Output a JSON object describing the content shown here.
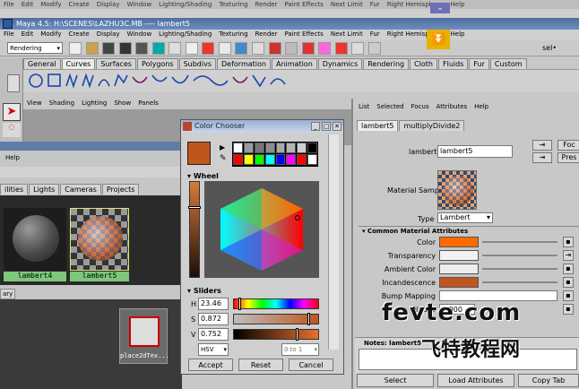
{
  "app_title_back": "Maya 4.5: H:\\SCENES\\LAZHU3C.MB  ----  lambert5",
  "app_title_front": "Maya 4.5: H:\\SCENES\\LAZHU3C.MB  ----  lambert5",
  "menubar": [
    "File",
    "Edit",
    "Modify",
    "Create",
    "Display",
    "Window",
    "Lighting/Shading",
    "Texturing",
    "Render",
    "Paint Effects",
    "Next Limit",
    "Fur",
    "Right Hemisphere",
    "Help"
  ],
  "menubar_front": [
    "File",
    "Edit",
    "Modify",
    "Create",
    "Display",
    "Window",
    "Lighting/Shading",
    "Texturing",
    "Render",
    "Paint Effects",
    "Next Limit",
    "Fur",
    "Right Hemisphere",
    "Help"
  ],
  "mode_select": "Rendering",
  "selection_label": "sel•",
  "shelf_tabs": [
    "General",
    "Curves",
    "Surfaces",
    "Polygons",
    "Subdivs",
    "Deformation",
    "Animation",
    "Dynamics",
    "Rendering",
    "Cloth",
    "Fluids",
    "Fur",
    "Custom"
  ],
  "shelf_active": "Curves",
  "viewport_menu": [
    "View",
    "Shading",
    "Lighting",
    "Show",
    "Panels"
  ],
  "hypershade": {
    "help": "Help",
    "tabs": [
      "ilities",
      "Lights",
      "Cameras",
      "Projects"
    ],
    "swatches": [
      "lambert4",
      "lambert5"
    ],
    "lower_tab": "ary",
    "node_label": "place2dTex..."
  },
  "color_chooser": {
    "title": "Color Chooser",
    "wheel_label": "Wheel",
    "sliders_label": "Sliders",
    "h_label": "H",
    "s_label": "S",
    "v_label": "V",
    "h_value": "23.46",
    "s_value": "0.872",
    "v_value": "0.752",
    "mode": "HSV",
    "range": "0 to 1",
    "accept": "Accept",
    "reset": "Reset",
    "cancel": "Cancel",
    "palette_row1": [
      "#ffffff",
      "#9a9a9a",
      "#777777",
      "#8d8d8d",
      "#a9a9a9",
      "#b5b5b5",
      "#cfcfcf",
      "#000000"
    ],
    "palette_row2": [
      "#ff0000",
      "#ffff00",
      "#00ff00",
      "#00ffff",
      "#0000ff",
      "#ff00ff",
      "#ff0000",
      "#ffffff"
    ],
    "current_color": "#c0561e"
  },
  "attr_editor": {
    "menu": [
      "List",
      "Selected",
      "Focus",
      "Attributes",
      "Help"
    ],
    "tabs": [
      "lambert5",
      "multiplyDivide2"
    ],
    "name_label": "lambert:",
    "name_value": "lambert5",
    "focus": "Foc",
    "presets": "Pres",
    "material_sample": "Material Sample",
    "type_label": "Type",
    "type_value": "Lambert",
    "section": "Common Material Attributes",
    "attrs": [
      "Color",
      "Transparency",
      "Ambient Color",
      "Incandescence",
      "Bump Mapping",
      "Diffuse"
    ],
    "diffuse_value": "1.000",
    "notes_label": "Notes: lambert5",
    "select": "Select",
    "load_attributes": "Load Attributes",
    "copy_tab": "Copy Tab"
  },
  "watermark_text": "fevte.com",
  "watermark_cn": "飞特教程网"
}
